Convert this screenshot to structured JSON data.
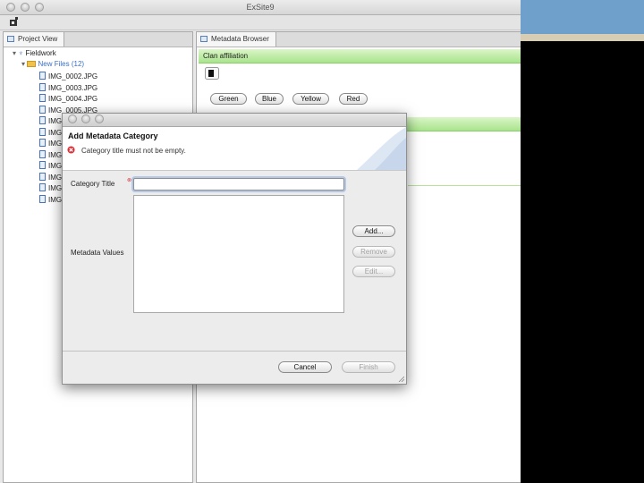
{
  "app": {
    "title": "ExSite9"
  },
  "project_view": {
    "tab_label": "Project View",
    "root_label": "Fieldwork",
    "folder_label": "New Files (12)",
    "files": [
      "IMG_0002.JPG",
      "IMG_0003.JPG",
      "IMG_0004.JPG",
      "IMG_0005.JPG",
      "IMG_",
      "IMG_",
      "IMG_",
      "IMG_",
      "IMG_",
      "IMG_",
      "IMG_",
      "IMG_"
    ]
  },
  "metadata_browser": {
    "tab_label": "Metadata Browser",
    "category_title": "Clan affiliation",
    "values": [
      "Green",
      "Blue",
      "Yellow",
      "Red"
    ]
  },
  "dialog": {
    "title": "Add Metadata Category",
    "error_message": "Category title must not be empty.",
    "category_title_label": "Category Title",
    "category_title_value": "",
    "metadata_values_label": "Metadata Values",
    "add_label": "Add...",
    "remove_label": "Remove",
    "edit_label": "Edit...",
    "cancel_label": "Cancel",
    "finish_label": "Finish"
  }
}
